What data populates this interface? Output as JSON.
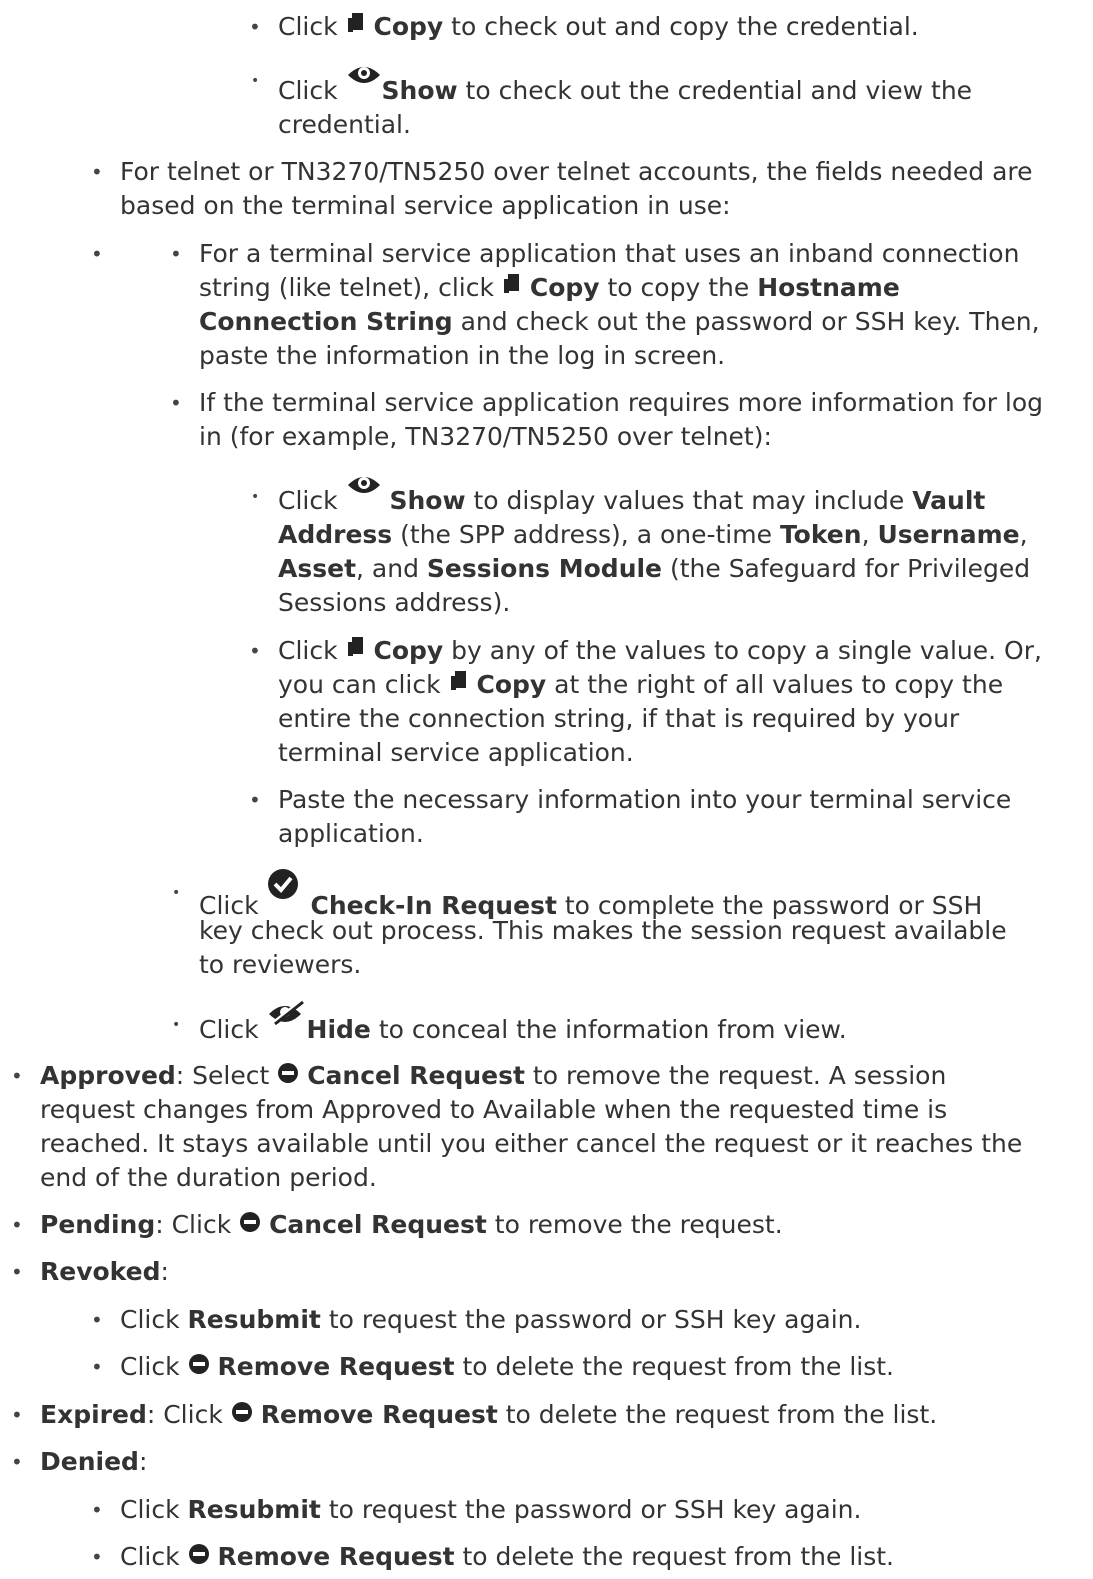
{
  "lines": {
    "l1": [
      "Click ",
      "Copy",
      " to check out and copy the credential."
    ],
    "l2": [
      "Click ",
      "Show",
      " to check out the credential and view the",
      "credential."
    ],
    "l3": [
      "For telnet or TN3270/TN5250 over telnet accounts, the fields needed are",
      "based on the terminal service application in use:"
    ],
    "l4": [
      "For a terminal service application that uses an inband connection",
      "string (like telnet), click ",
      "Copy",
      " to copy the ",
      "Hostname",
      "Connection String",
      " and check out the password or SSH key. Then,",
      "paste the information in the log in screen."
    ],
    "l5": [
      "If the terminal service application requires more information for log",
      "in (for example, TN3270/TN5250 over telnet):"
    ],
    "l6": [
      "Click ",
      "Show",
      " to display values that may include ",
      "Vault",
      "Address",
      " (the SPP address), a one-time ",
      "Token",
      ", ",
      "Username",
      ",",
      "Asset",
      ", and ",
      "Sessions Module",
      " (the Safeguard for Privileged",
      "Sessions address)."
    ],
    "l7": [
      "Click ",
      "Copy",
      " by any of the values to copy a single value. Or,",
      "you can click ",
      "Copy",
      " at the right of all values to copy the",
      "entire the connection string, if that is required by your",
      "terminal service application."
    ],
    "l8": [
      "Paste the necessary information into your terminal service",
      "application."
    ],
    "l9": [
      "Click ",
      "Check-In Request",
      " to complete the password or SSH",
      "key check out process. This makes the session request available",
      "to reviewers."
    ],
    "l10": [
      "Click ",
      "Hide",
      " to conceal the information from view."
    ],
    "l11": [
      "Approved",
      ": Select ",
      "Cancel Request",
      " to remove the request. A session",
      "request changes from Approved to Available when the requested time is",
      "reached. It stays available until you either cancel the request or it reaches the",
      "end of the duration period."
    ],
    "l12": [
      "Pending",
      ": Click ",
      "Cancel Request",
      " to remove the request."
    ],
    "l13": [
      "Revoked",
      ":"
    ],
    "l14": [
      "Click ",
      "Resubmit",
      " to request the password or SSH key again."
    ],
    "l15": [
      "Click ",
      "Remove Request",
      " to delete the request from the list."
    ],
    "l16": [
      "Expired",
      ": Click ",
      "Remove Request",
      " to delete the request from the list."
    ],
    "l17": [
      "Denied",
      ":"
    ],
    "l18": [
      "Click ",
      "Resubmit",
      " to request the password or SSH key again."
    ],
    "l19": [
      "Click ",
      "Remove Request",
      " to delete the request from the list."
    ]
  },
  "icons": {
    "copy": "copy-icon",
    "show": "eye-icon",
    "hide": "eye-slash-icon",
    "check": "check-circle-icon",
    "cancel": "minus-circle-icon"
  }
}
